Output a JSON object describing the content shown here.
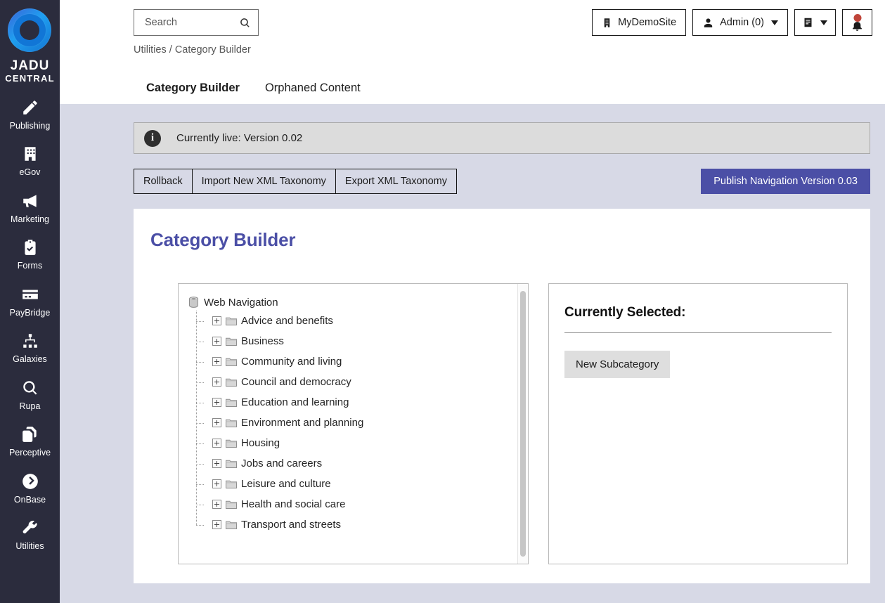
{
  "brand": {
    "logo_line1": "JADU",
    "logo_line2": "CENTRAL",
    "logo_icon": "jadu-ring-logo"
  },
  "sidebar": {
    "items": [
      {
        "label": "Publishing",
        "icon": "pencil-icon"
      },
      {
        "label": "eGov",
        "icon": "building-icon"
      },
      {
        "label": "Marketing",
        "icon": "megaphone-icon"
      },
      {
        "label": "Forms",
        "icon": "clipboard-check-icon"
      },
      {
        "label": "PayBridge",
        "icon": "credit-card-icon"
      },
      {
        "label": "Galaxies",
        "icon": "sitemap-icon"
      },
      {
        "label": "Rupa",
        "icon": "magnifier-icon"
      },
      {
        "label": "Perceptive",
        "icon": "copy-documents-icon"
      },
      {
        "label": "OnBase",
        "icon": "circle-chevron-right-icon"
      },
      {
        "label": "Utilities",
        "icon": "wrench-icon"
      }
    ]
  },
  "header": {
    "search": {
      "placeholder": "Search",
      "value": "",
      "icon": "search-icon"
    },
    "breadcrumb": "Utilities / Category Builder",
    "site_button": {
      "label": "MyDemoSite",
      "icon": "building-small-icon"
    },
    "admin_button": {
      "label": "Admin (0)",
      "icon": "user-icon",
      "caret": "chevron-down-icon"
    },
    "manual_button": {
      "icon": "book-icon",
      "caret": "chevron-down-icon"
    },
    "notifications_button": {
      "icon": "bell-icon",
      "badge_color": "#c0453a"
    }
  },
  "tabs": [
    {
      "label": "Category Builder",
      "active": true
    },
    {
      "label": "Orphaned Content",
      "active": false
    }
  ],
  "alert": {
    "icon": "info-icon",
    "icon_glyph": "i",
    "text": "Currently live: Version 0.02"
  },
  "actions": {
    "group": [
      {
        "label": "Rollback"
      },
      {
        "label": "Import New XML Taxonomy"
      },
      {
        "label": "Export XML Taxonomy"
      }
    ],
    "publish": {
      "label": "Publish Navigation Version 0.03",
      "color": "#4b4fa6"
    }
  },
  "card": {
    "title": "Category Builder",
    "title_color": "#4b4fa6"
  },
  "tree": {
    "root": {
      "label": "Web Navigation",
      "icon": "database-drum-icon"
    },
    "nodes": [
      {
        "label": "Advice and benefits",
        "icon": "folder-icon",
        "expander": "plus-box-icon"
      },
      {
        "label": "Business",
        "icon": "folder-icon",
        "expander": "plus-box-icon"
      },
      {
        "label": "Community and living",
        "icon": "folder-icon",
        "expander": "plus-box-icon"
      },
      {
        "label": "Council and democracy",
        "icon": "folder-icon",
        "expander": "plus-box-icon"
      },
      {
        "label": "Education and learning",
        "icon": "folder-icon",
        "expander": "plus-box-icon"
      },
      {
        "label": "Environment and planning",
        "icon": "folder-icon",
        "expander": "plus-box-icon"
      },
      {
        "label": "Housing",
        "icon": "folder-icon",
        "expander": "plus-box-icon"
      },
      {
        "label": "Jobs and careers",
        "icon": "folder-icon",
        "expander": "plus-box-icon"
      },
      {
        "label": "Leisure and culture",
        "icon": "folder-icon",
        "expander": "plus-box-icon"
      },
      {
        "label": "Health and social care",
        "icon": "folder-icon",
        "expander": "plus-box-icon"
      },
      {
        "label": "Transport and streets",
        "icon": "folder-icon",
        "expander": "plus-box-icon"
      }
    ]
  },
  "selection": {
    "title": "Currently Selected:",
    "value": "",
    "new_subcategory_label": "New Subcategory"
  }
}
